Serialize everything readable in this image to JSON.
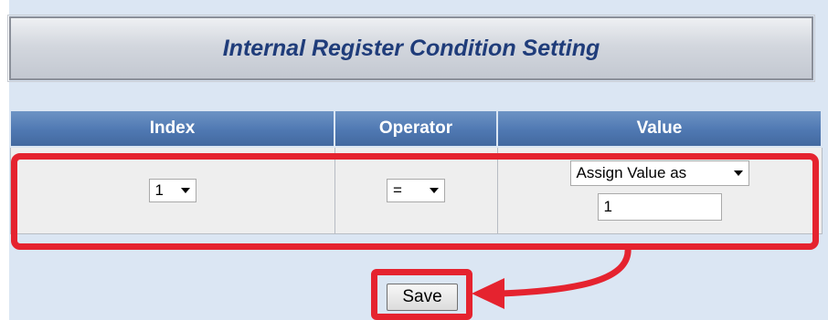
{
  "title": "Internal Register Condition Setting",
  "table": {
    "columns": [
      "Index",
      "Operator",
      "Value"
    ],
    "row": {
      "index": "1",
      "operator": "=",
      "value_mode": "Assign Value as",
      "value": "1"
    }
  },
  "save_label": "Save",
  "colors": {
    "header_blue": "#4f78b2",
    "title_text": "#1f3c7a",
    "highlight": "#e5232f",
    "page_bg": "#dbe6f3"
  }
}
